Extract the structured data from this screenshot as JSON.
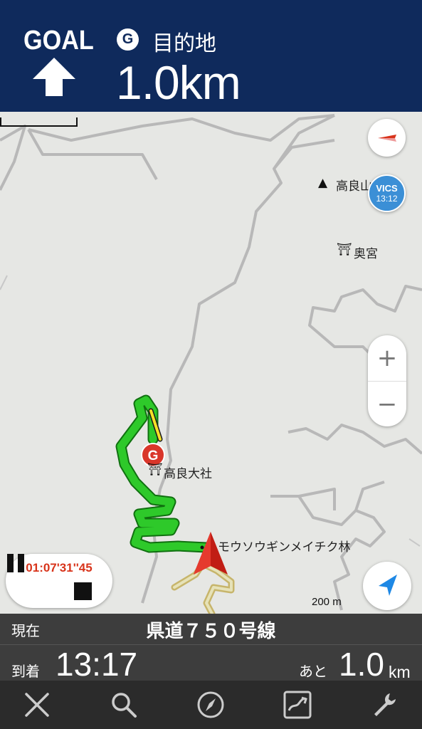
{
  "header": {
    "goal_label": "GOAL",
    "badge": "G",
    "destination": "目的地",
    "distance": "1.0km"
  },
  "map": {
    "labels": {
      "mountain": "高良山",
      "okumiya": "奥宮",
      "shrine": "高良大社",
      "forest": "モウソウギンメイチク林",
      "goal_marker": "G"
    },
    "vics": {
      "title": "VICS",
      "time": "13:12"
    },
    "zoom": {
      "in": "+",
      "out": "−"
    },
    "scale": "200 m",
    "timer": "01:07'31''45"
  },
  "info": {
    "current_label": "現在",
    "road_name": "県道７５０号線",
    "arrival_label": "到着",
    "arrival_time": "13:17",
    "remaining_label": "あと",
    "remaining_value": "1.0",
    "remaining_unit": "km"
  },
  "colors": {
    "header_bg": "#0f2a5c",
    "route_green": "#2ec92a",
    "goal_red": "#d9362a",
    "vics_blue": "#3b8fd6",
    "locate_blue": "#1e88e5"
  },
  "icons": [
    "goal-arrow-icon",
    "compass-icon",
    "shrine-icon",
    "mountain-icon",
    "pause-icon",
    "stop-icon",
    "location-arrow-icon",
    "close-icon",
    "search-icon",
    "compass-nav-icon",
    "route-icon",
    "wrench-icon"
  ]
}
